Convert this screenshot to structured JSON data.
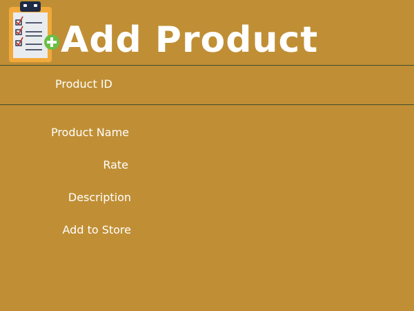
{
  "header": {
    "title": "Add Product",
    "icon": "clipboard-add-icon"
  },
  "form": {
    "product_id_label": "Product ID",
    "product_name_label": "Product Name",
    "rate_label": "Rate",
    "description_label": "Description",
    "add_to_store_label": "Add to Store"
  },
  "colors": {
    "background": "#c08f35",
    "divider": "#3c4a2b",
    "text": "#ffffff",
    "clipboard_board": "#f2a93b",
    "clipboard_clip": "#1f2a44",
    "add_badge": "#6abf45"
  }
}
